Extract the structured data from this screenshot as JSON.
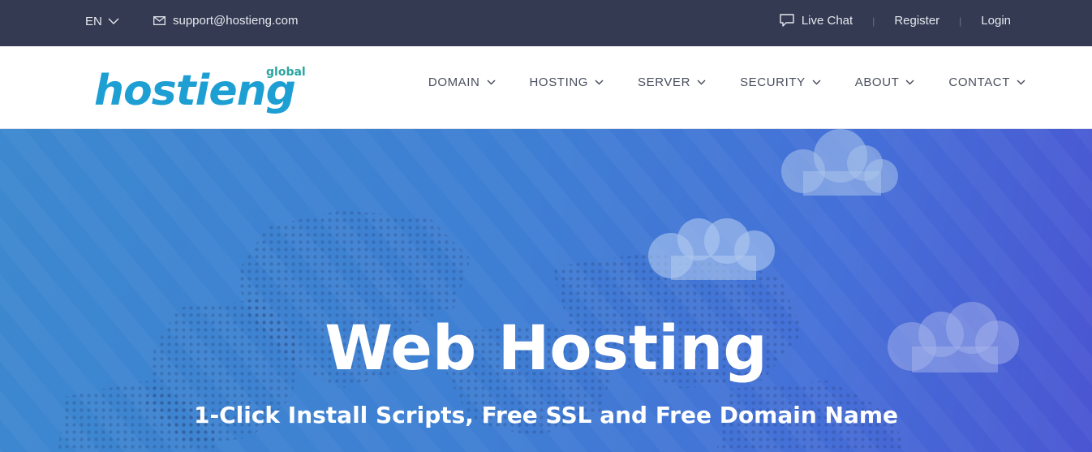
{
  "topbar": {
    "language": "EN",
    "email": "support@hostieng.com",
    "links": [
      "Live Chat",
      "Register",
      "Login"
    ]
  },
  "brand": {
    "name": "hostieng",
    "tag": "global",
    "colors": {
      "primary": "#1e9fd3",
      "tag": "#2aa5a0"
    }
  },
  "nav": {
    "items": [
      "DOMAIN",
      "HOSTING",
      "SERVER",
      "SECURITY",
      "ABOUT",
      "CONTACT"
    ]
  },
  "hero": {
    "title": "Web Hosting",
    "subtitle": "1-Click Install Scripts, Free SSL and Free Domain Name"
  },
  "icons": {
    "language_chevron": "chevron-down-icon",
    "email": "envelope-icon",
    "chat": "chat-bubble-icon",
    "nav_chevron": "chevron-down-icon"
  }
}
